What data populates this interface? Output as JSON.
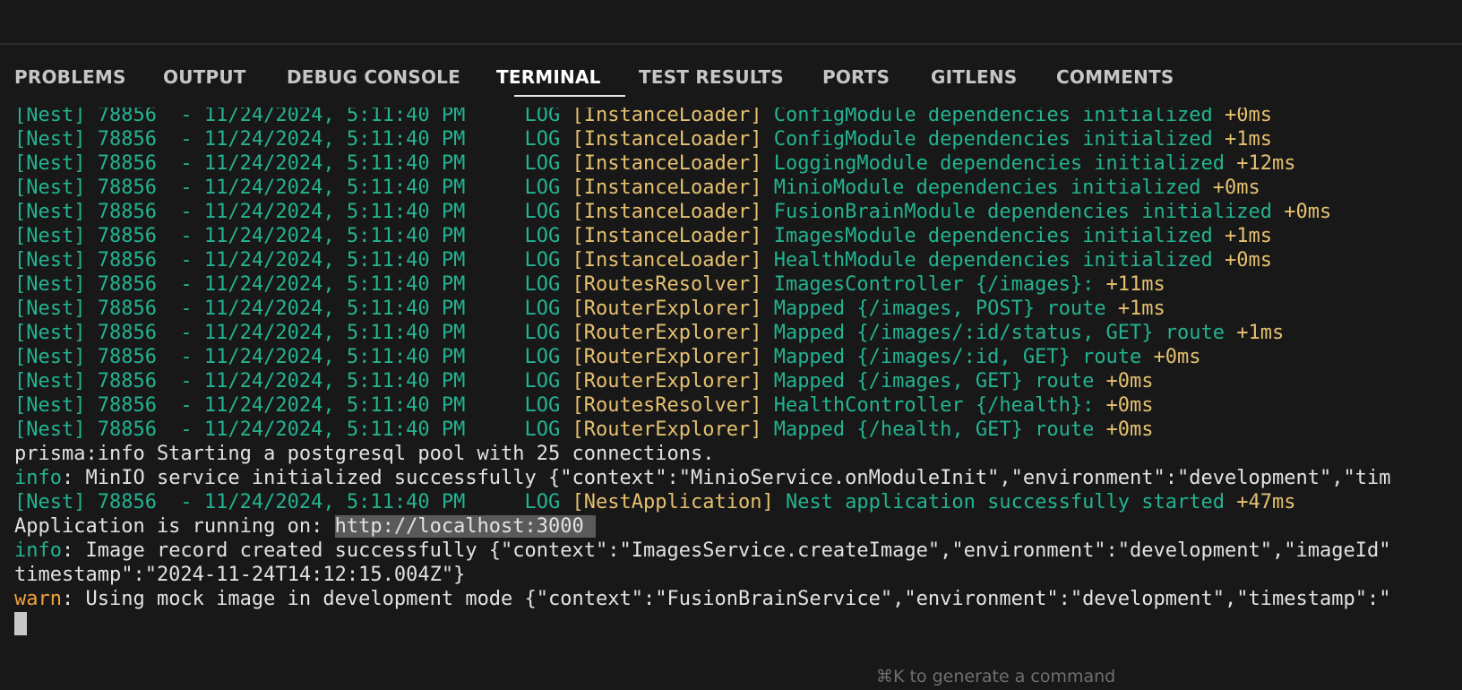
{
  "panel": {
    "tabs": [
      {
        "label": "PROBLEMS"
      },
      {
        "label": "OUTPUT"
      },
      {
        "label": "DEBUG CONSOLE"
      },
      {
        "label": "TERMINAL"
      },
      {
        "label": "TEST RESULTS"
      },
      {
        "label": "PORTS"
      },
      {
        "label": "GITLENS"
      },
      {
        "label": "COMMENTS"
      }
    ],
    "active_tab": "TERMINAL"
  },
  "terminal": {
    "nest_prefix": "[Nest] 78856  - 11/24/2024, 5:11:40 PM     LOG ",
    "nest_lines": [
      {
        "ctx": "[InstanceLoader]",
        "msg": " ConfigModule dependencies initialized ",
        "time": "+0ms"
      },
      {
        "ctx": "[InstanceLoader]",
        "msg": " ConfigModule dependencies initialized ",
        "time": "+1ms"
      },
      {
        "ctx": "[InstanceLoader]",
        "msg": " LoggingModule dependencies initialized ",
        "time": "+12ms"
      },
      {
        "ctx": "[InstanceLoader]",
        "msg": " MinioModule dependencies initialized ",
        "time": "+0ms"
      },
      {
        "ctx": "[InstanceLoader]",
        "msg": " FusionBrainModule dependencies initialized ",
        "time": "+0ms"
      },
      {
        "ctx": "[InstanceLoader]",
        "msg": " ImagesModule dependencies initialized ",
        "time": "+1ms"
      },
      {
        "ctx": "[InstanceLoader]",
        "msg": " HealthModule dependencies initialized ",
        "time": "+0ms"
      },
      {
        "ctx": "[RoutesResolver]",
        "msg": " ImagesController {/images}: ",
        "time": "+11ms"
      },
      {
        "ctx": "[RouterExplorer]",
        "msg": " Mapped {/images, POST} route ",
        "time": "+1ms"
      },
      {
        "ctx": "[RouterExplorer]",
        "msg": " Mapped {/images/:id/status, GET} route ",
        "time": "+1ms"
      },
      {
        "ctx": "[RouterExplorer]",
        "msg": " Mapped {/images/:id, GET} route ",
        "time": "+0ms"
      },
      {
        "ctx": "[RouterExplorer]",
        "msg": " Mapped {/images, GET} route ",
        "time": "+0ms"
      },
      {
        "ctx": "[RoutesResolver]",
        "msg": " HealthController {/health}: ",
        "time": "+0ms"
      },
      {
        "ctx": "[RouterExplorer]",
        "msg": " Mapped {/health, GET} route ",
        "time": "+0ms"
      }
    ],
    "prisma_line": "prisma:info Starting a postgresql pool with 25 connections.",
    "minio_line": {
      "level": "info",
      "text": ": MinIO service initialized successfully {\"context\":\"MinioService.onModuleInit\",\"environment\":\"development\",\"tim"
    },
    "app_started": {
      "ctx": "[NestApplication]",
      "msg": " Nest application successfully started ",
      "time": "+47ms"
    },
    "running_line": {
      "text": "Application is running on: ",
      "url": "http://localhost:3000 "
    },
    "image_record_line": {
      "level": "info",
      "text": ": Image record created successfully {\"context\":\"ImagesService.createImage\",\"environment\":\"development\",\"imageId\""
    },
    "timestamp_line": "timestamp\":\"2024-11-24T14:12:15.004Z\"}",
    "warn_line": {
      "level": "warn",
      "text": ": Using mock image in development mode {\"context\":\"FusionBrainService\",\"environment\":\"development\",\"timestamp\":\""
    }
  },
  "hint": "⌘K to generate a command",
  "colors": {
    "background": "#181818",
    "log_green": "#23b391",
    "context_yellow": "#e5c06f",
    "warn_orange": "#f0a23b"
  }
}
